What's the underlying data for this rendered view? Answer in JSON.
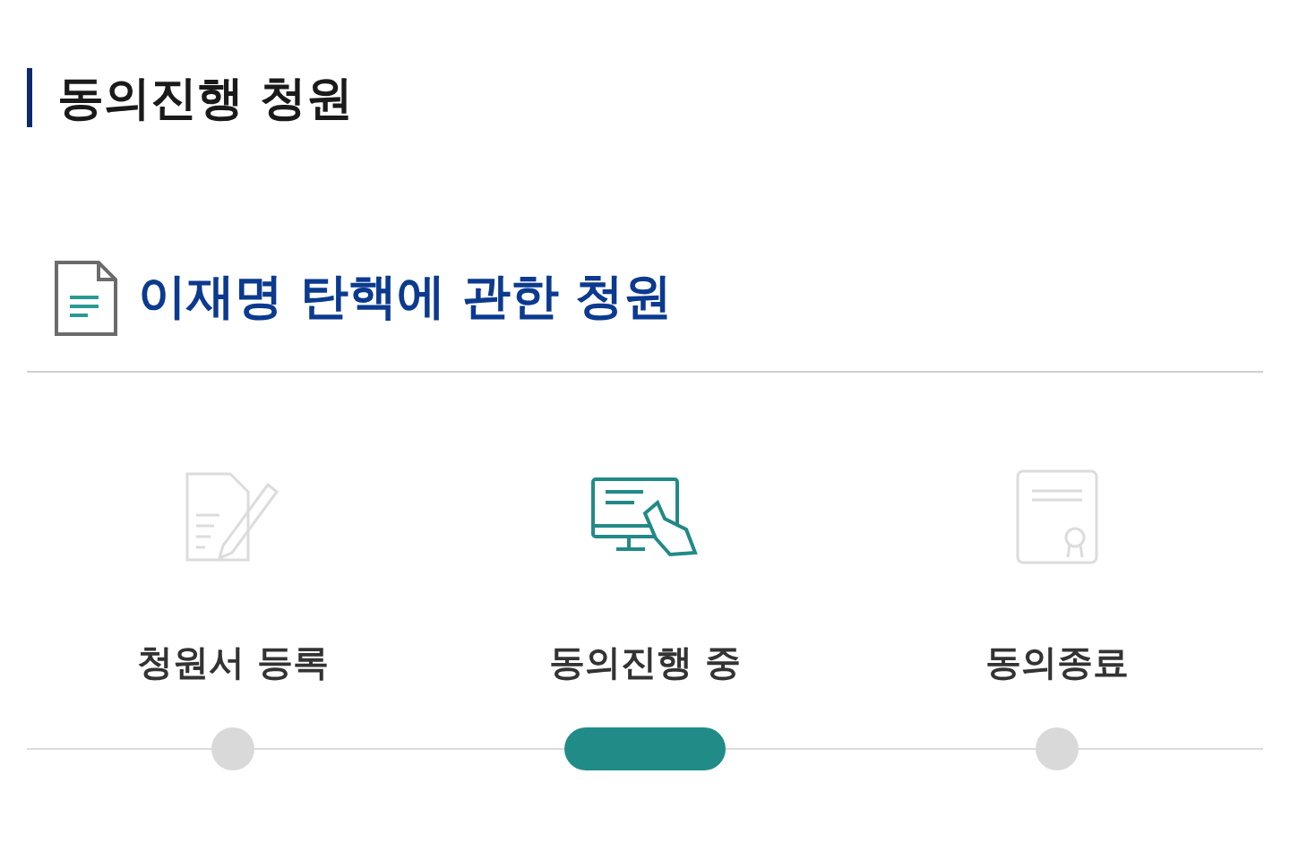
{
  "heading": "동의진행 청원",
  "petition": {
    "title": "이재명 탄핵에 관한 청원"
  },
  "steps": [
    {
      "kind": "register",
      "label": "청원서 등록",
      "selected": false
    },
    {
      "kind": "consent",
      "label": "동의진행 중",
      "selected": true
    },
    {
      "kind": "closed",
      "label": "동의종료",
      "selected": false
    }
  ]
}
